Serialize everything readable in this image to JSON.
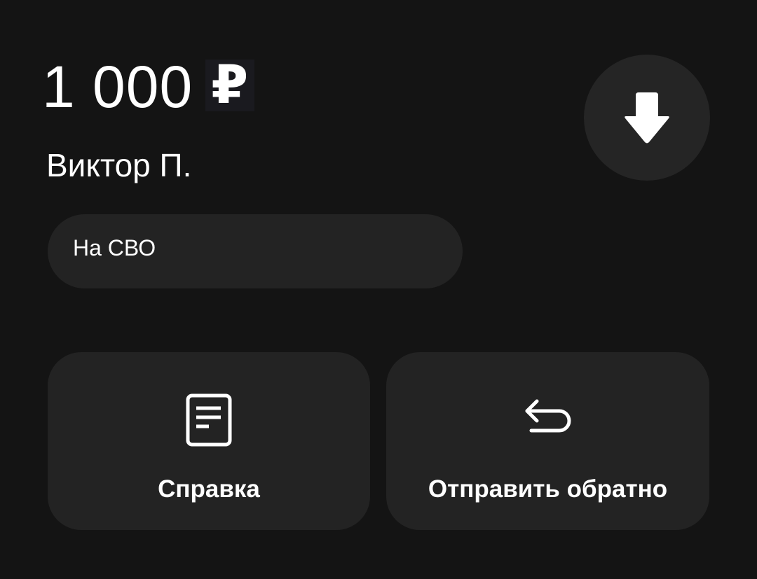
{
  "transaction": {
    "amount": "1 000",
    "currency_symbol": "₽",
    "recipient": "Виктор П.",
    "comment": "На СВО"
  },
  "actions": {
    "download_icon": "arrow-down-icon",
    "receipt_label": "Справка",
    "receipt_icon": "document-icon",
    "return_label": "Отправить обратно",
    "return_icon": "return-arrow-icon"
  }
}
